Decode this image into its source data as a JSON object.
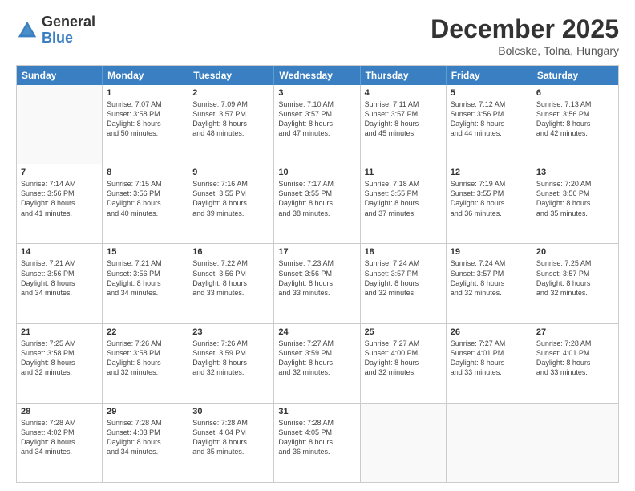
{
  "logo": {
    "general": "General",
    "blue": "Blue"
  },
  "title": "December 2025",
  "subtitle": "Bolcske, Tolna, Hungary",
  "header_days": [
    "Sunday",
    "Monday",
    "Tuesday",
    "Wednesday",
    "Thursday",
    "Friday",
    "Saturday"
  ],
  "weeks": [
    [
      {
        "day": "",
        "info": ""
      },
      {
        "day": "1",
        "info": "Sunrise: 7:07 AM\nSunset: 3:58 PM\nDaylight: 8 hours\nand 50 minutes."
      },
      {
        "day": "2",
        "info": "Sunrise: 7:09 AM\nSunset: 3:57 PM\nDaylight: 8 hours\nand 48 minutes."
      },
      {
        "day": "3",
        "info": "Sunrise: 7:10 AM\nSunset: 3:57 PM\nDaylight: 8 hours\nand 47 minutes."
      },
      {
        "day": "4",
        "info": "Sunrise: 7:11 AM\nSunset: 3:57 PM\nDaylight: 8 hours\nand 45 minutes."
      },
      {
        "day": "5",
        "info": "Sunrise: 7:12 AM\nSunset: 3:56 PM\nDaylight: 8 hours\nand 44 minutes."
      },
      {
        "day": "6",
        "info": "Sunrise: 7:13 AM\nSunset: 3:56 PM\nDaylight: 8 hours\nand 42 minutes."
      }
    ],
    [
      {
        "day": "7",
        "info": "Sunrise: 7:14 AM\nSunset: 3:56 PM\nDaylight: 8 hours\nand 41 minutes."
      },
      {
        "day": "8",
        "info": "Sunrise: 7:15 AM\nSunset: 3:56 PM\nDaylight: 8 hours\nand 40 minutes."
      },
      {
        "day": "9",
        "info": "Sunrise: 7:16 AM\nSunset: 3:55 PM\nDaylight: 8 hours\nand 39 minutes."
      },
      {
        "day": "10",
        "info": "Sunrise: 7:17 AM\nSunset: 3:55 PM\nDaylight: 8 hours\nand 38 minutes."
      },
      {
        "day": "11",
        "info": "Sunrise: 7:18 AM\nSunset: 3:55 PM\nDaylight: 8 hours\nand 37 minutes."
      },
      {
        "day": "12",
        "info": "Sunrise: 7:19 AM\nSunset: 3:55 PM\nDaylight: 8 hours\nand 36 minutes."
      },
      {
        "day": "13",
        "info": "Sunrise: 7:20 AM\nSunset: 3:56 PM\nDaylight: 8 hours\nand 35 minutes."
      }
    ],
    [
      {
        "day": "14",
        "info": "Sunrise: 7:21 AM\nSunset: 3:56 PM\nDaylight: 8 hours\nand 34 minutes."
      },
      {
        "day": "15",
        "info": "Sunrise: 7:21 AM\nSunset: 3:56 PM\nDaylight: 8 hours\nand 34 minutes."
      },
      {
        "day": "16",
        "info": "Sunrise: 7:22 AM\nSunset: 3:56 PM\nDaylight: 8 hours\nand 33 minutes."
      },
      {
        "day": "17",
        "info": "Sunrise: 7:23 AM\nSunset: 3:56 PM\nDaylight: 8 hours\nand 33 minutes."
      },
      {
        "day": "18",
        "info": "Sunrise: 7:24 AM\nSunset: 3:57 PM\nDaylight: 8 hours\nand 32 minutes."
      },
      {
        "day": "19",
        "info": "Sunrise: 7:24 AM\nSunset: 3:57 PM\nDaylight: 8 hours\nand 32 minutes."
      },
      {
        "day": "20",
        "info": "Sunrise: 7:25 AM\nSunset: 3:57 PM\nDaylight: 8 hours\nand 32 minutes."
      }
    ],
    [
      {
        "day": "21",
        "info": "Sunrise: 7:25 AM\nSunset: 3:58 PM\nDaylight: 8 hours\nand 32 minutes."
      },
      {
        "day": "22",
        "info": "Sunrise: 7:26 AM\nSunset: 3:58 PM\nDaylight: 8 hours\nand 32 minutes."
      },
      {
        "day": "23",
        "info": "Sunrise: 7:26 AM\nSunset: 3:59 PM\nDaylight: 8 hours\nand 32 minutes."
      },
      {
        "day": "24",
        "info": "Sunrise: 7:27 AM\nSunset: 3:59 PM\nDaylight: 8 hours\nand 32 minutes."
      },
      {
        "day": "25",
        "info": "Sunrise: 7:27 AM\nSunset: 4:00 PM\nDaylight: 8 hours\nand 32 minutes."
      },
      {
        "day": "26",
        "info": "Sunrise: 7:27 AM\nSunset: 4:01 PM\nDaylight: 8 hours\nand 33 minutes."
      },
      {
        "day": "27",
        "info": "Sunrise: 7:28 AM\nSunset: 4:01 PM\nDaylight: 8 hours\nand 33 minutes."
      }
    ],
    [
      {
        "day": "28",
        "info": "Sunrise: 7:28 AM\nSunset: 4:02 PM\nDaylight: 8 hours\nand 34 minutes."
      },
      {
        "day": "29",
        "info": "Sunrise: 7:28 AM\nSunset: 4:03 PM\nDaylight: 8 hours\nand 34 minutes."
      },
      {
        "day": "30",
        "info": "Sunrise: 7:28 AM\nSunset: 4:04 PM\nDaylight: 8 hours\nand 35 minutes."
      },
      {
        "day": "31",
        "info": "Sunrise: 7:28 AM\nSunset: 4:05 PM\nDaylight: 8 hours\nand 36 minutes."
      },
      {
        "day": "",
        "info": ""
      },
      {
        "day": "",
        "info": ""
      },
      {
        "day": "",
        "info": ""
      }
    ]
  ]
}
